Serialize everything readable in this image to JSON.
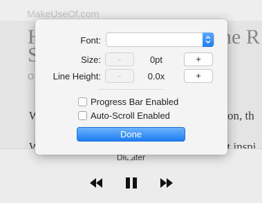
{
  "background": {
    "site_tag": "MakeUseOf.com",
    "title_left_1": "H",
    "title_right_1": "ne R",
    "title_left_2": "S",
    "sub_left": "O",
    "body_line1_left": "W",
    "body_line1_right": "ation, th",
    "body_line2_left": "W",
    "body_line2_right": "ot inspi"
  },
  "player": {
    "title": "Dictater",
    "icons": {
      "rewind": "rewind-icon",
      "pause": "pause-icon",
      "forward": "fast-forward-icon"
    }
  },
  "popover": {
    "font": {
      "label": "Font:",
      "value": ""
    },
    "size": {
      "label": "Size:",
      "decrement": "-",
      "value": "0pt",
      "increment": "+"
    },
    "line_height": {
      "label": "Line Height:",
      "decrement": "-",
      "value": "0.0x",
      "increment": "+"
    },
    "progress_bar": {
      "label": "Progress Bar Enabled",
      "checked": false
    },
    "auto_scroll": {
      "label": "Auto-Scroll Enabled",
      "checked": false
    },
    "done_label": "Done"
  },
  "colors": {
    "accent": "#1e7cf2",
    "popover_bg": "#f4f4f4"
  }
}
